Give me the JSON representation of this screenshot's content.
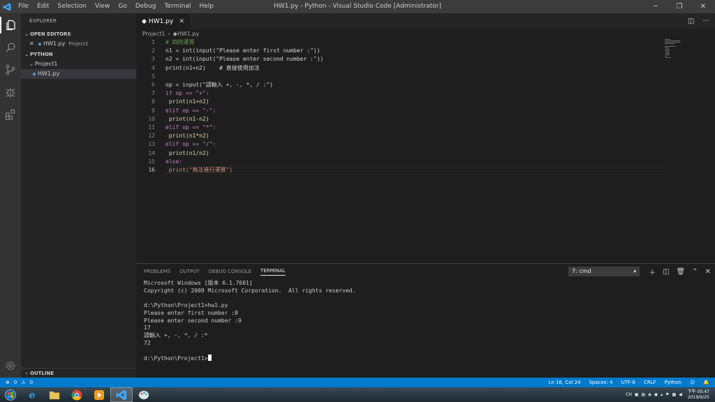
{
  "titlebar": {
    "menu": [
      "File",
      "Edit",
      "Selection",
      "View",
      "Go",
      "Debug",
      "Terminal",
      "Help"
    ],
    "window_title": "HW1.py - Python - Visual Studio Code [Administrator]"
  },
  "sidebar": {
    "title": "EXPLORER",
    "open_editors_label": "OPEN EDITORS",
    "open_editor_file": "HW1.py",
    "open_editor_folder": "Project1",
    "workspace_label": "PYTHON",
    "folder": "Project1",
    "file": "HW1.py",
    "outline_label": "OUTLINE"
  },
  "tab": {
    "label": "HW1.py"
  },
  "breadcrumb": {
    "folder": "Project1",
    "file": "HW1.py"
  },
  "editor": {
    "current_line": 16,
    "lines": [
      "# 四則運算",
      "n1 = int(input(\"Please enter first number :\"))",
      "n2 = int(input(\"Please enter second number :\"))",
      "print(n1+n2)    # 直接使用加法",
      "",
      "op = input(\"請輸入 +, -, *, / :\")",
      "if op == \"+\":",
      " print(n1+n2)",
      "elif op == \"-\":",
      " print(n1-n2)",
      "elif op == \"*\":",
      " print(n1*n2)",
      "elif op == \"/\":",
      " print(n1/n2)",
      "else:",
      " print(\"無法進行運算\")"
    ]
  },
  "panel": {
    "tabs": [
      "PROBLEMS",
      "OUTPUT",
      "DEBUG CONSOLE",
      "TERMINAL"
    ],
    "active_tab": "TERMINAL",
    "terminal_select": "7: cmd",
    "terminal_lines": [
      "Microsoft Windows [版本 6.1.7601]",
      "Copyright (c) 2009 Microsoft Corporation.  All rights reserved.",
      "",
      "d:\\Python\\Project1>hw1.py",
      "Please enter first number :8",
      "Please enter second number :9",
      "17",
      "請輸入 +, -, *, / :*",
      "72",
      "",
      "d:\\Python\\Project1>"
    ]
  },
  "statusbar": {
    "errors": "0",
    "warnings": "0",
    "position": "Ln 16, Col 24",
    "spaces": "Spaces: 4",
    "encoding": "UTF-8",
    "eol": "CRLF",
    "language": "Python"
  },
  "taskbar": {
    "ime": "CH",
    "time": "下午 05:47",
    "date": "2019/9/25"
  },
  "colors": {
    "activity_bar": "#333333",
    "sidebar": "#252526",
    "editor": "#1e1e1e",
    "statusbar": "#007acc",
    "keyword": "#c586c0",
    "string": "#ce9178",
    "comment": "#6a9955",
    "function": "#dcdcaa"
  }
}
